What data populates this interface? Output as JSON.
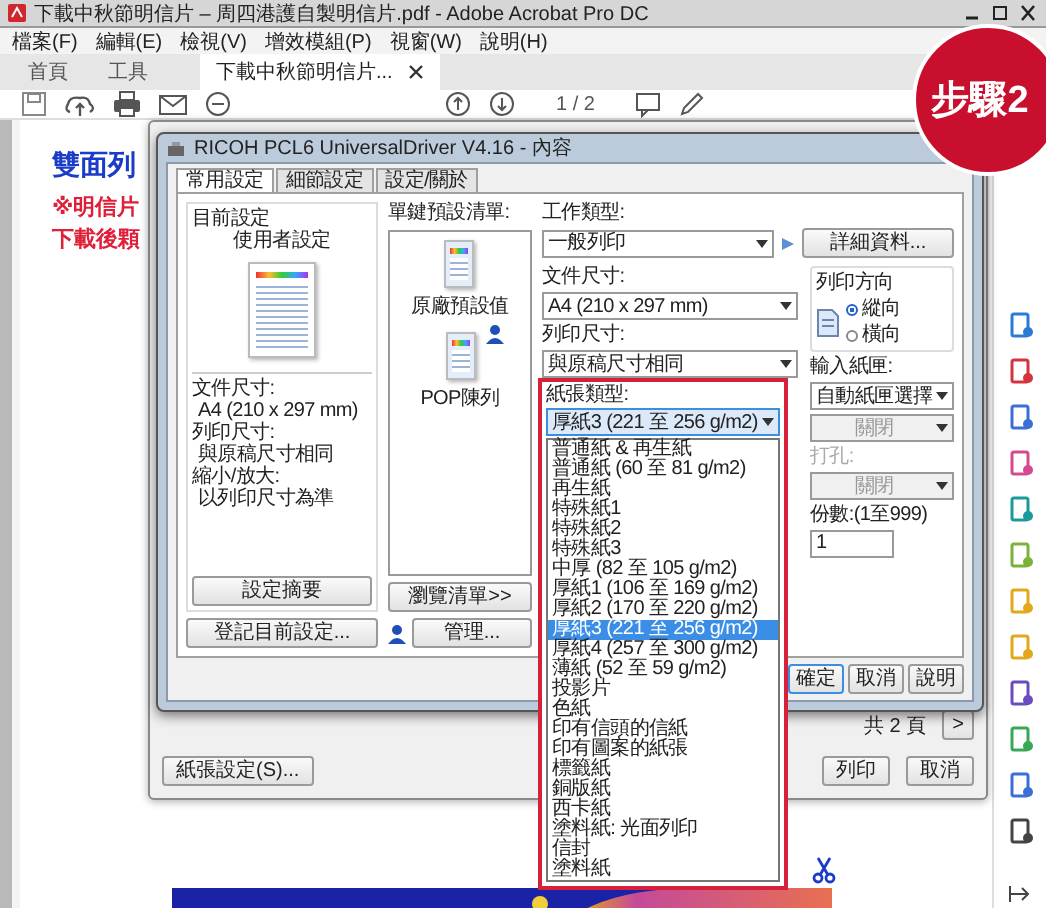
{
  "window": {
    "title": "下載中秋節明信片 – 周四港護自製明信片.pdf - Adobe Acrobat Pro DC"
  },
  "menu": [
    "檔案(F)",
    "編輯(E)",
    "檢視(V)",
    "增效模組(P)",
    "視窗(W)",
    "說明(H)"
  ],
  "tabs": [
    {
      "label": "首頁",
      "selected": false
    },
    {
      "label": "工具",
      "selected": false
    },
    {
      "label": "下載中秋節明信片...",
      "selected": true
    }
  ],
  "toolbar": {
    "page": "1 / 2"
  },
  "step_badge": "步驟2",
  "document": {
    "lines": [
      {
        "text": "雙面列",
        "kind": "heading"
      },
      {
        "text": "※明信片",
        "kind": "note"
      },
      {
        "text": "下載後顆",
        "kind": "note"
      }
    ]
  },
  "print_dialog": {
    "next": ">",
    "page_count": "共 2 頁",
    "page_setup_button": "紙張設定(S)...",
    "print_button": "列印",
    "cancel_button": "取消"
  },
  "properties_dialog": {
    "title": "RICOH PCL6 UniversalDriver V4.16 - 內容",
    "tabs": [
      {
        "label": "常用設定",
        "selected": true
      },
      {
        "label": "細節設定",
        "selected": false
      },
      {
        "label": "設定/關於",
        "selected": false
      }
    ],
    "current_settings": {
      "heading": "目前設定",
      "name": "使用者設定",
      "details": [
        {
          "label": "文件尺寸:",
          "value": "A4 (210 x 297 mm)"
        },
        {
          "label": "列印尺寸:",
          "value": "與原稿尺寸相同"
        },
        {
          "label": "縮小/放大:",
          "value": "以列印尺寸為準"
        }
      ],
      "summary_button": "設定摘要"
    },
    "register_button": "登記目前設定...",
    "presets": {
      "label": "單鍵預設清單:",
      "items": [
        {
          "name": "原廠預設值",
          "user": false
        },
        {
          "name": "POP陳列",
          "user": true
        }
      ],
      "browse_button": "瀏覽清單>>",
      "manage_button": "管理..."
    },
    "job_type": {
      "label": "工作類型:",
      "value": "一般列印",
      "details_button": "詳細資料..."
    },
    "document_size": {
      "label": "文件尺寸:",
      "value": "A4 (210 x 297 mm)"
    },
    "print_size": {
      "label": "列印尺寸:",
      "value": "與原稿尺寸相同"
    },
    "paper_type": {
      "label": "紙張類型:",
      "value": "厚紙3 (221 至 256 g/m2)",
      "options": [
        {
          "label": "普通紙 & 再生紙",
          "selected": false
        },
        {
          "label": "普通紙 (60 至 81 g/m2)",
          "selected": false
        },
        {
          "label": "再生紙",
          "selected": false
        },
        {
          "label": "特殊紙1",
          "selected": false
        },
        {
          "label": "特殊紙2",
          "selected": false
        },
        {
          "label": "特殊紙3",
          "selected": false
        },
        {
          "label": "中厚 (82 至 105 g/m2)",
          "selected": false
        },
        {
          "label": "厚紙1 (106 至 169 g/m2)",
          "selected": false
        },
        {
          "label": "厚紙2 (170 至 220 g/m2)",
          "selected": false
        },
        {
          "label": "厚紙3 (221 至 256 g/m2)",
          "selected": true
        },
        {
          "label": "厚紙4 (257 至 300 g/m2)",
          "selected": false
        },
        {
          "label": "薄紙 (52 至 59 g/m2)",
          "selected": false
        },
        {
          "label": "投影片",
          "selected": false
        },
        {
          "label": "色紙",
          "selected": false
        },
        {
          "label": "印有信頭的信紙",
          "selected": false
        },
        {
          "label": "印有圖案的紙張",
          "selected": false
        },
        {
          "label": "標籤紙",
          "selected": false
        },
        {
          "label": "銅版紙",
          "selected": false
        },
        {
          "label": "西卡紙",
          "selected": false
        },
        {
          "label": "塗料紙: 光面列印",
          "selected": false
        },
        {
          "label": "信封",
          "selected": false
        },
        {
          "label": "塗料紙",
          "selected": false
        }
      ]
    },
    "orientation": {
      "label": "列印方向",
      "options": [
        {
          "label": "縱向",
          "selected": true
        },
        {
          "label": "橫向",
          "selected": false
        }
      ]
    },
    "input_tray": {
      "label": "輸入紙匣:",
      "value": "自動紙匣選擇"
    },
    "setting_1": {
      "value": "關閉",
      "disabled": true
    },
    "punch": {
      "label": "打孔:",
      "value": "關閉",
      "disabled": true
    },
    "copies": {
      "label": "份數:(1至999)",
      "value": "1"
    },
    "buttons": [
      "確定",
      "取消",
      "說明"
    ]
  }
}
